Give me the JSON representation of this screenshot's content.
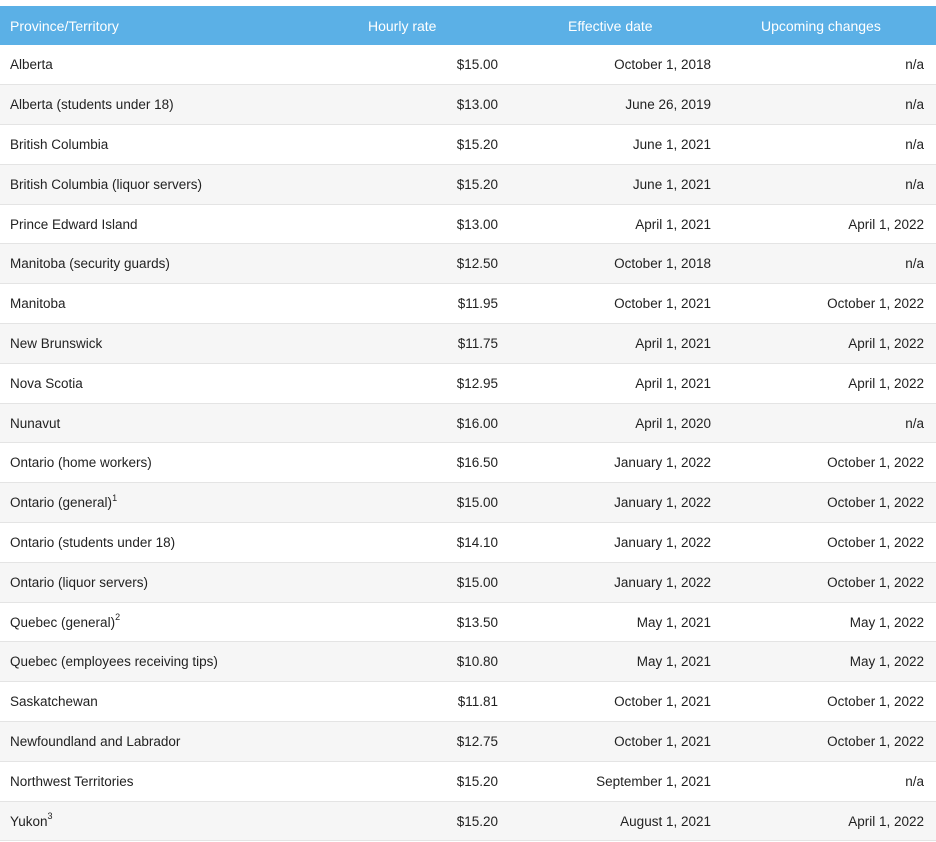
{
  "headers": {
    "province": "Province/Territory",
    "rate": "Hourly rate",
    "effective": "Effective date",
    "upcoming": "Upcoming changes"
  },
  "rows": [
    {
      "province": "Alberta",
      "sup": "",
      "rate": "$15.00",
      "effective": "October 1, 2018",
      "upcoming": "n/a"
    },
    {
      "province": "Alberta (students under 18)",
      "sup": "",
      "rate": "$13.00",
      "effective": "June 26, 2019",
      "upcoming": "n/a"
    },
    {
      "province": "British Columbia",
      "sup": "",
      "rate": "$15.20",
      "effective": "June 1, 2021",
      "upcoming": "n/a"
    },
    {
      "province": "British Columbia (liquor servers)",
      "sup": "",
      "rate": "$15.20",
      "effective": "June 1, 2021",
      "upcoming": "n/a"
    },
    {
      "province": "Prince Edward Island",
      "sup": "",
      "rate": "$13.00",
      "effective": "April 1, 2021",
      "upcoming": "April 1, 2022"
    },
    {
      "province": "Manitoba (security guards)",
      "sup": "",
      "rate": "$12.50",
      "effective": "October 1, 2018",
      "upcoming": "n/a"
    },
    {
      "province": "Manitoba",
      "sup": "",
      "rate": "$11.95",
      "effective": "October 1, 2021",
      "upcoming": "October 1, 2022"
    },
    {
      "province": "New Brunswick",
      "sup": "",
      "rate": "$11.75",
      "effective": "April 1, 2021",
      "upcoming": "April 1, 2022"
    },
    {
      "province": "Nova Scotia",
      "sup": "",
      "rate": "$12.95",
      "effective": "April 1, 2021",
      "upcoming": "April 1, 2022"
    },
    {
      "province": "Nunavut",
      "sup": "",
      "rate": "$16.00",
      "effective": "April 1, 2020",
      "upcoming": "n/a"
    },
    {
      "province": "Ontario (home workers)",
      "sup": "",
      "rate": "$16.50",
      "effective": "January 1, 2022",
      "upcoming": "October 1, 2022"
    },
    {
      "province": "Ontario (general)",
      "sup": "1",
      "rate": "$15.00",
      "effective": "January 1, 2022",
      "upcoming": "October 1, 2022"
    },
    {
      "province": "Ontario (students under 18)",
      "sup": "",
      "rate": "$14.10",
      "effective": "January 1, 2022",
      "upcoming": "October 1, 2022"
    },
    {
      "province": "Ontario (liquor servers)",
      "sup": "",
      "rate": "$15.00",
      "effective": "January 1, 2022",
      "upcoming": "October 1, 2022"
    },
    {
      "province": "Quebec (general)",
      "sup": "2",
      "rate": "$13.50",
      "effective": "May 1, 2021",
      "upcoming": "May 1, 2022"
    },
    {
      "province": "Quebec (employees receiving tips)",
      "sup": "",
      "rate": "$10.80",
      "effective": "May 1, 2021",
      "upcoming": "May 1, 2022"
    },
    {
      "province": "Saskatchewan",
      "sup": "",
      "rate": "$11.81",
      "effective": "October 1, 2021",
      "upcoming": "October 1, 2022"
    },
    {
      "province": "Newfoundland and Labrador",
      "sup": "",
      "rate": "$12.75",
      "effective": "October 1, 2021",
      "upcoming": "October 1, 2022"
    },
    {
      "province": "Northwest Territories",
      "sup": "",
      "rate": "$15.20",
      "effective": "September 1, 2021",
      "upcoming": "n/a"
    },
    {
      "province": "Yukon",
      "sup": "3",
      "rate": "$15.20",
      "effective": "August 1, 2021",
      "upcoming": "April 1, 2022"
    }
  ]
}
